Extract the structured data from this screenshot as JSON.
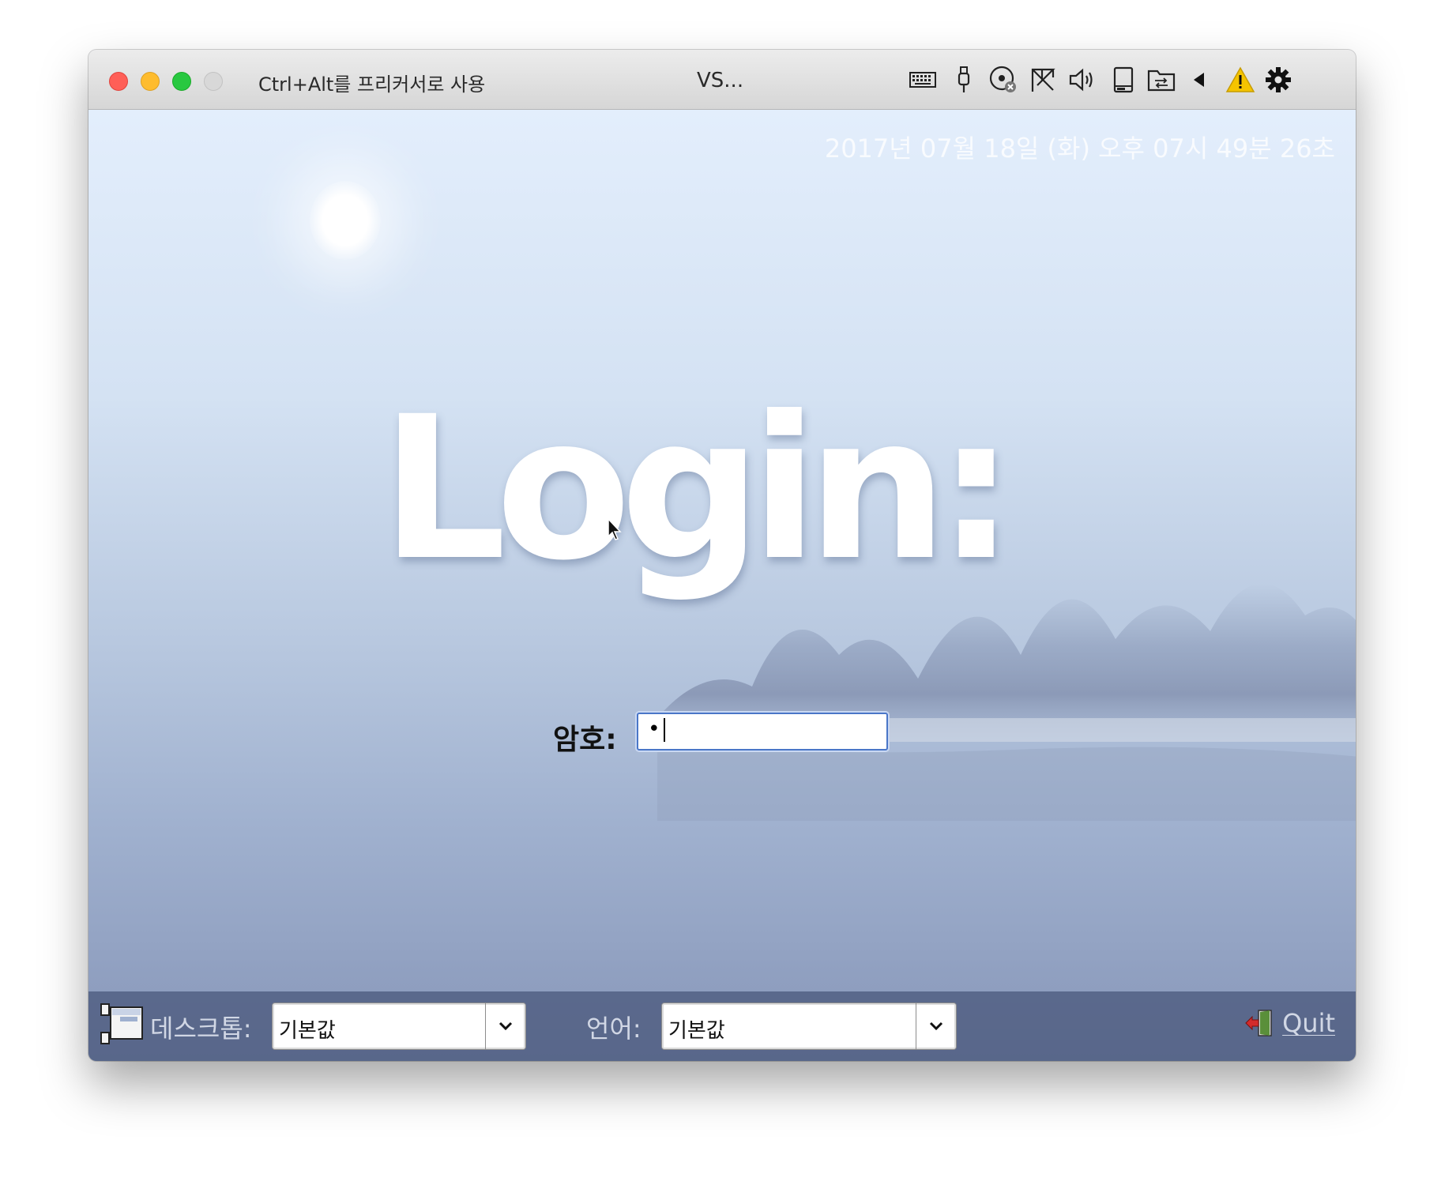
{
  "titlebar": {
    "hint": "Ctrl+Alt를 프리커서로 사용",
    "title": "VS...",
    "toolbar_icons": [
      "keyboard-icon",
      "usb-icon",
      "cd-dvd-icon",
      "network-icon",
      "audio-icon",
      "hard-disk-icon",
      "shared-folder-icon",
      "back-triangle-icon",
      "warning-icon",
      "settings-gear-icon"
    ]
  },
  "screen": {
    "clock": "2017년 07월 18일 (화) 오후 07시 49분 26초",
    "logo_text": "Login:",
    "password_label": "암호:",
    "password_value": "•"
  },
  "bottombar": {
    "desktop_label": "데스크톱:",
    "desktop_value": "기본값",
    "language_label": "언어:",
    "language_value": "기본값",
    "quit_label": "Quit"
  },
  "colors": {
    "close": "#ff5f57",
    "minimize": "#febc2e",
    "maximize": "#28c840",
    "input_focus": "#4a76c8",
    "warning": "#f5c400"
  }
}
